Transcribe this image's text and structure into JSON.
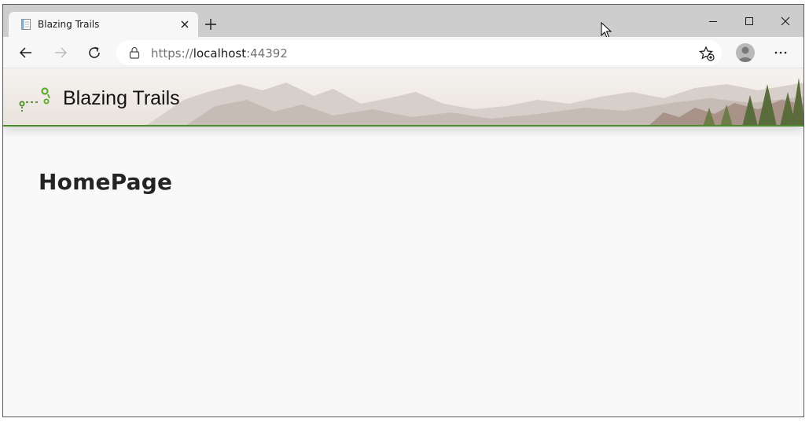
{
  "browser": {
    "tab": {
      "title": "Blazing Trails",
      "favicon": "page-icon"
    },
    "new_tab_icon": "plus-icon",
    "window_controls": [
      "minimize-icon",
      "maximize-icon",
      "close-icon"
    ],
    "address_bar": {
      "scheme": "https://",
      "host": "localhost",
      "port": ":44392"
    },
    "toolbar_icons": [
      "back-arrow-icon",
      "forward-arrow-icon",
      "refresh-icon",
      "lock-icon",
      "favorite-star-icon",
      "profile-avatar-icon",
      "more-options-icon"
    ]
  },
  "app": {
    "brand_name": "Blazing Trails",
    "accent_color": "#4b8b2b",
    "logo": "trail-logo-icon"
  },
  "main": {
    "heading": "HomePage"
  }
}
